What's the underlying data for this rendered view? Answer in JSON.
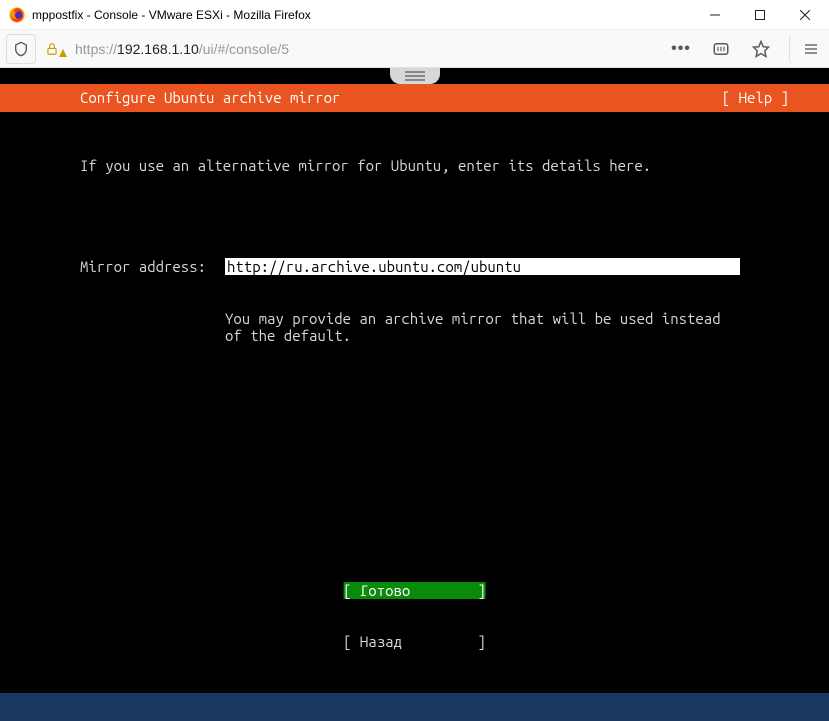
{
  "window": {
    "title": "mppostfix - Console - VMware ESXi - Mozilla Firefox"
  },
  "urlbar": {
    "prefix": "https://",
    "host": "192.168.1.10",
    "path": "/ui/#/console/5"
  },
  "installer": {
    "header_title": "Configure Ubuntu archive mirror",
    "help_label": "[ Help ]",
    "intro": "If you use an alternative mirror for Ubuntu, enter its details here.",
    "mirror_label": "Mirror address:",
    "mirror_value": "http://ru.archive.ubuntu.com/ubuntu",
    "mirror_hint": "You may provide an archive mirror that will be used instead of the default.",
    "done_raw": "[ Готово        ]",
    "back_raw": "[ Назад         ]"
  }
}
